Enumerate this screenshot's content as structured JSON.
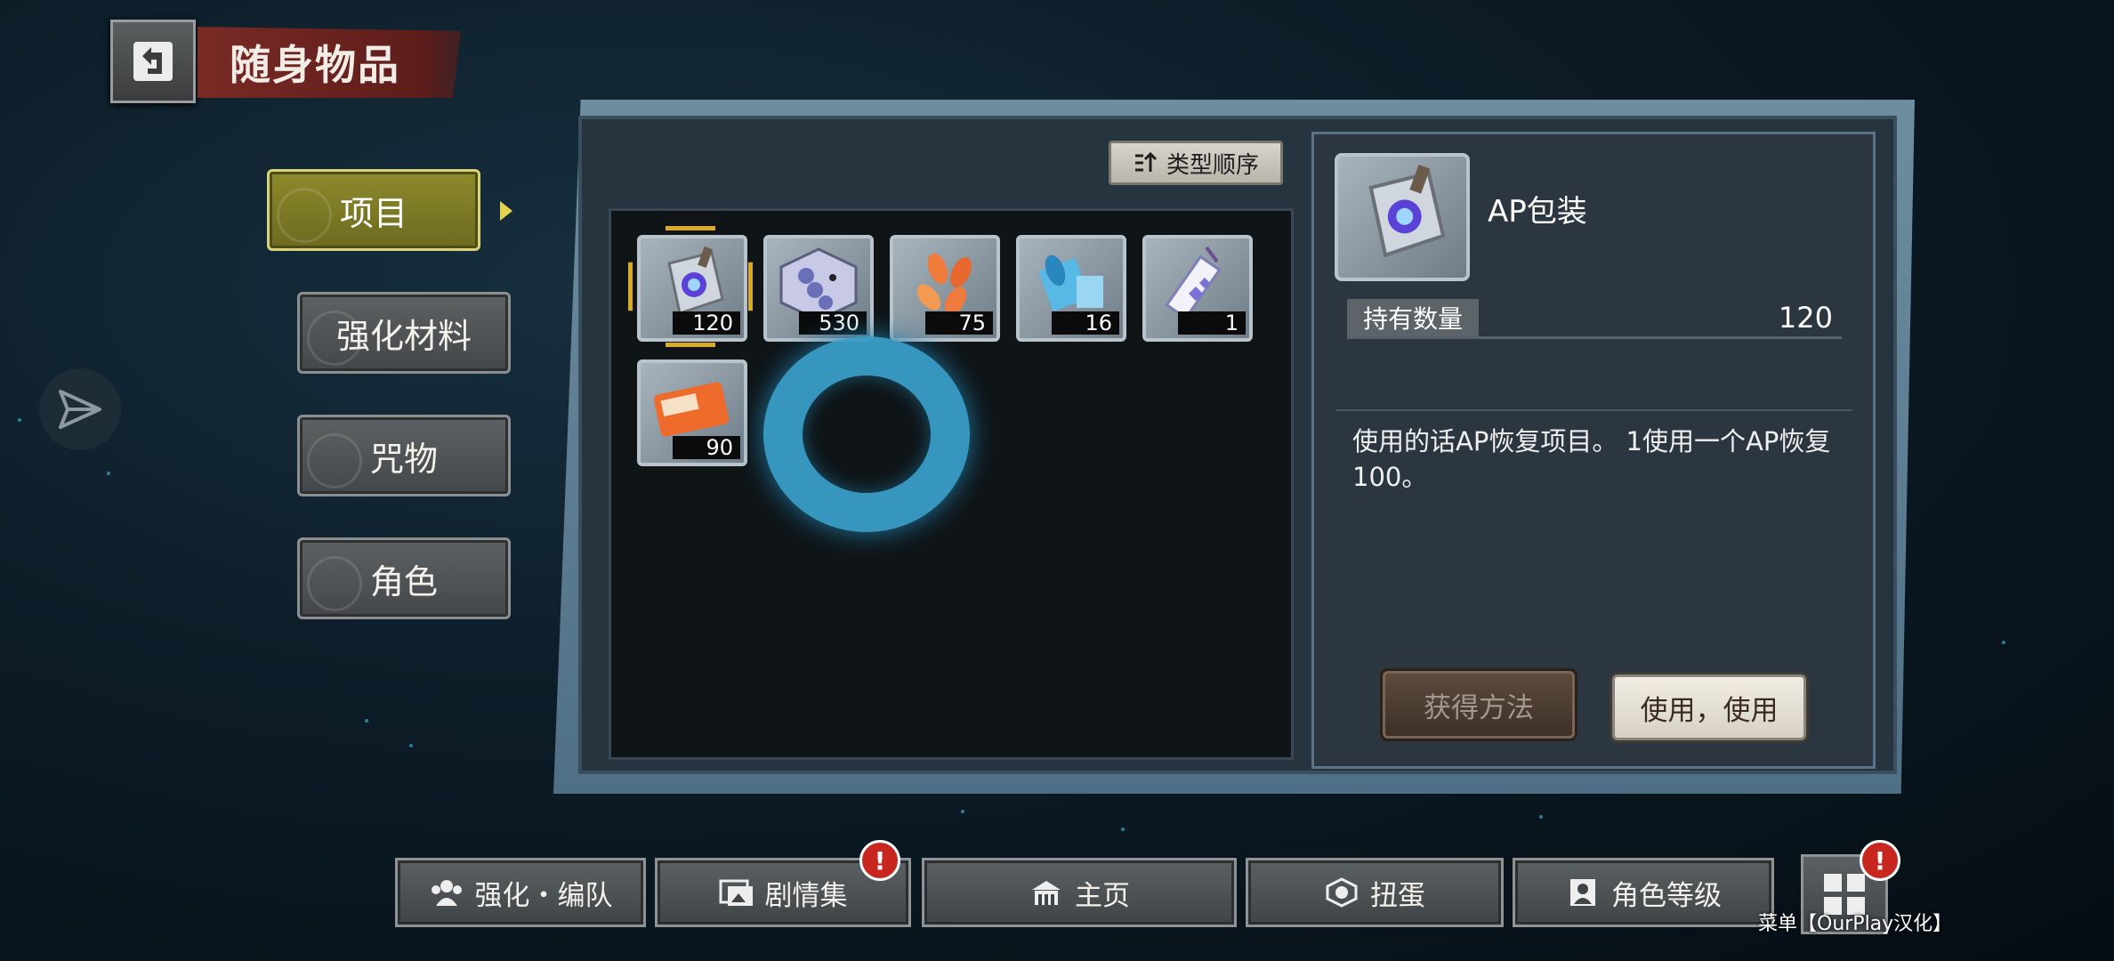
{
  "header": {
    "title": "随身物品"
  },
  "side_tabs": [
    {
      "label": "项目",
      "active": true
    },
    {
      "label": "强化材料",
      "active": false
    },
    {
      "label": "咒物",
      "active": false
    },
    {
      "label": "角色",
      "active": false
    }
  ],
  "sort_button": {
    "label": "类型顺序",
    "icon": "sort-icon"
  },
  "items": [
    {
      "count": "120",
      "icon": "ap-package-icon",
      "selected": true
    },
    {
      "count": "530",
      "icon": "beads-card-icon"
    },
    {
      "count": "75",
      "icon": "orange-petals-icon"
    },
    {
      "count": "16",
      "icon": "blue-scroll-icon"
    },
    {
      "count": "1",
      "icon": "charm-tag-icon"
    },
    {
      "count": "90",
      "icon": "ticket-card-icon"
    }
  ],
  "detail": {
    "name": "AP包装",
    "owned_label": "持有数量",
    "owned_value": "120",
    "description": "使用的话AP恢复项目。 1使用一个AP恢复100。",
    "obtain_button": "获得方法",
    "use_button": "使用，使用"
  },
  "bottom_nav": [
    {
      "label": "强化・编队",
      "icon": "team-icon"
    },
    {
      "label": "剧情集",
      "icon": "story-icon",
      "badge": "!"
    },
    {
      "label": "主页",
      "icon": "home-icon"
    },
    {
      "label": "扭蛋",
      "icon": "gacha-icon"
    },
    {
      "label": "角色等级",
      "icon": "character-icon"
    }
  ],
  "menu": {
    "label": "菜单【OurPlay汉化】",
    "badge": "!"
  },
  "colors": {
    "accent_gold": "#d9a928",
    "active_tab": "#8d8a2c",
    "title_red": "#7a2a25",
    "badge_red": "#c8271f"
  }
}
